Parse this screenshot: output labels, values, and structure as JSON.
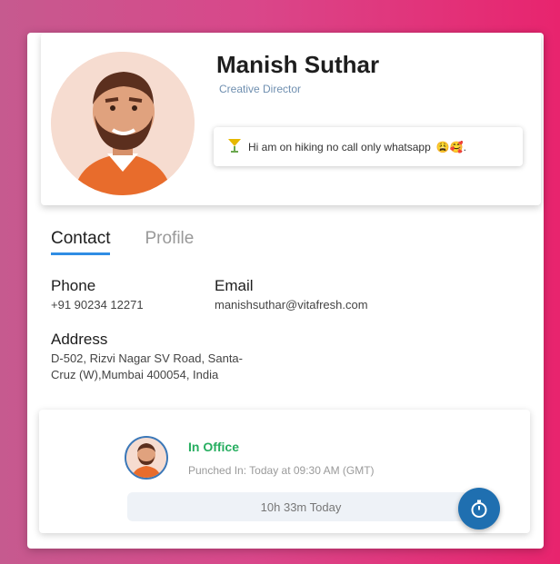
{
  "profile": {
    "name": "Manish Suthar",
    "role": "Creative Director",
    "status_message": "Hi am on hiking no call only whatsapp",
    "status_icon": "cocktail-icon",
    "status_emojis": "😩🥰."
  },
  "tabs": [
    {
      "label": "Contact",
      "active": true
    },
    {
      "label": "Profile",
      "active": false
    }
  ],
  "contact": {
    "phone_label": "Phone",
    "phone_value": "+91 90234 12271",
    "email_label": "Email",
    "email_value": "manishsuthar@vitafresh.com",
    "address_label": "Address",
    "address_line1": "D-502, Rizvi Nagar SV Road, Santa-",
    "address_line2": "Cruz (W),Mumbai 400054, India"
  },
  "attendance": {
    "status": "In Office",
    "punched_in": "Punched In: Today at 09:30 AM (GMT)",
    "duration": "10h 33m Today",
    "timer_icon": "stopwatch-icon"
  },
  "colors": {
    "accent": "#2f8de4",
    "in_office": "#27ae60",
    "timer_button": "#1f6fb0"
  }
}
